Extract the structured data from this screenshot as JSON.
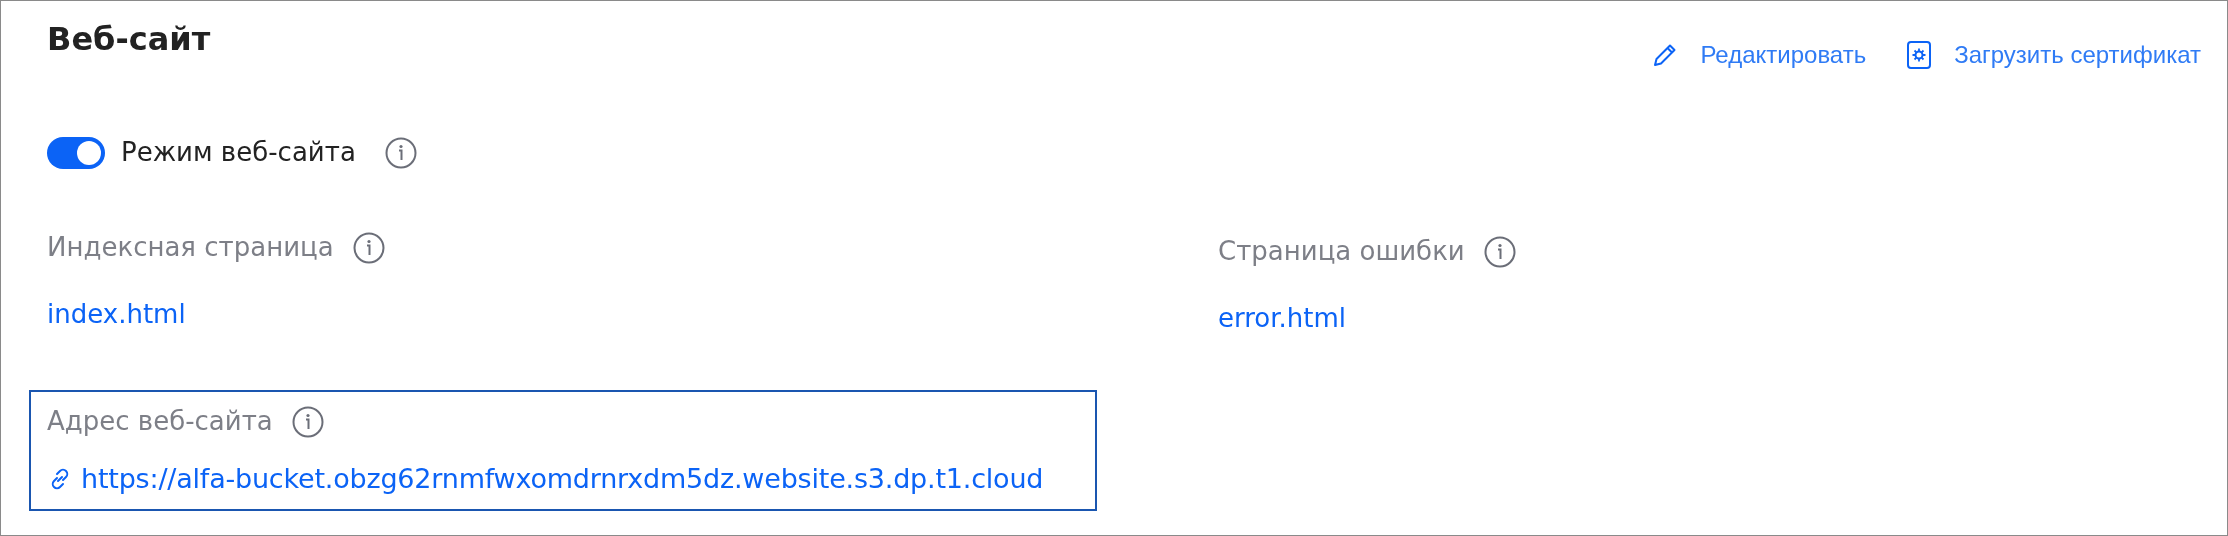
{
  "title": "Веб-сайт",
  "actions": [
    {
      "kind": "edit",
      "label": "Редактировать"
    },
    {
      "kind": "certificate",
      "label": "Загрузить сертификат"
    }
  ],
  "website_mode": {
    "label": "Режим веб-сайта",
    "on": true
  },
  "index_page": {
    "label": "Индексная страница",
    "value": "index.html"
  },
  "error_page": {
    "label": "Страница ошибки",
    "value": "error.html"
  },
  "website_address": {
    "label": "Адрес веб-сайта",
    "value": "https://alfa-bucket.obzg62rnmfwxomdrnrxdm5dz.website.s3.dp.t1.cloud",
    "highlighted": true
  }
}
